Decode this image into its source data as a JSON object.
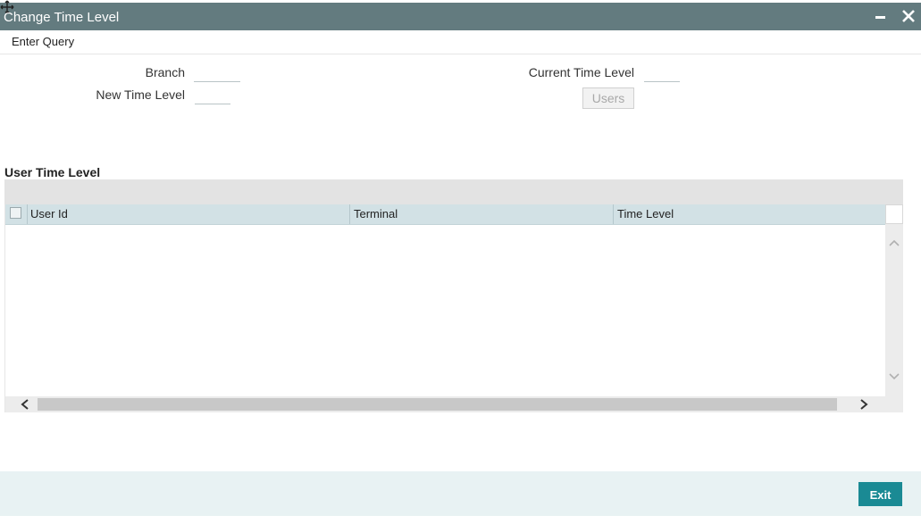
{
  "window": {
    "title": "Change Time Level",
    "minimize_icon": "minimize-icon",
    "close_icon": "close-icon",
    "move_icon": "move-cursor-icon"
  },
  "menu": {
    "items": [
      {
        "label": "Enter Query"
      }
    ]
  },
  "form": {
    "branch_label": "Branch",
    "branch_value": "",
    "new_time_level_label": "New Time Level",
    "new_time_level_value": "",
    "current_time_level_label": "Current Time Level",
    "current_time_level_value": "",
    "users_button_label": "Users"
  },
  "grid": {
    "title": "User Time Level",
    "columns": [
      "User Id",
      "Terminal",
      "Time Level"
    ],
    "rows": []
  },
  "footer": {
    "exit_label": "Exit"
  },
  "colors": {
    "titlebar": "#637b7f",
    "header_row": "#d2e1e5",
    "footer": "#e8f2f3",
    "exit_button": "#1a8a94"
  }
}
